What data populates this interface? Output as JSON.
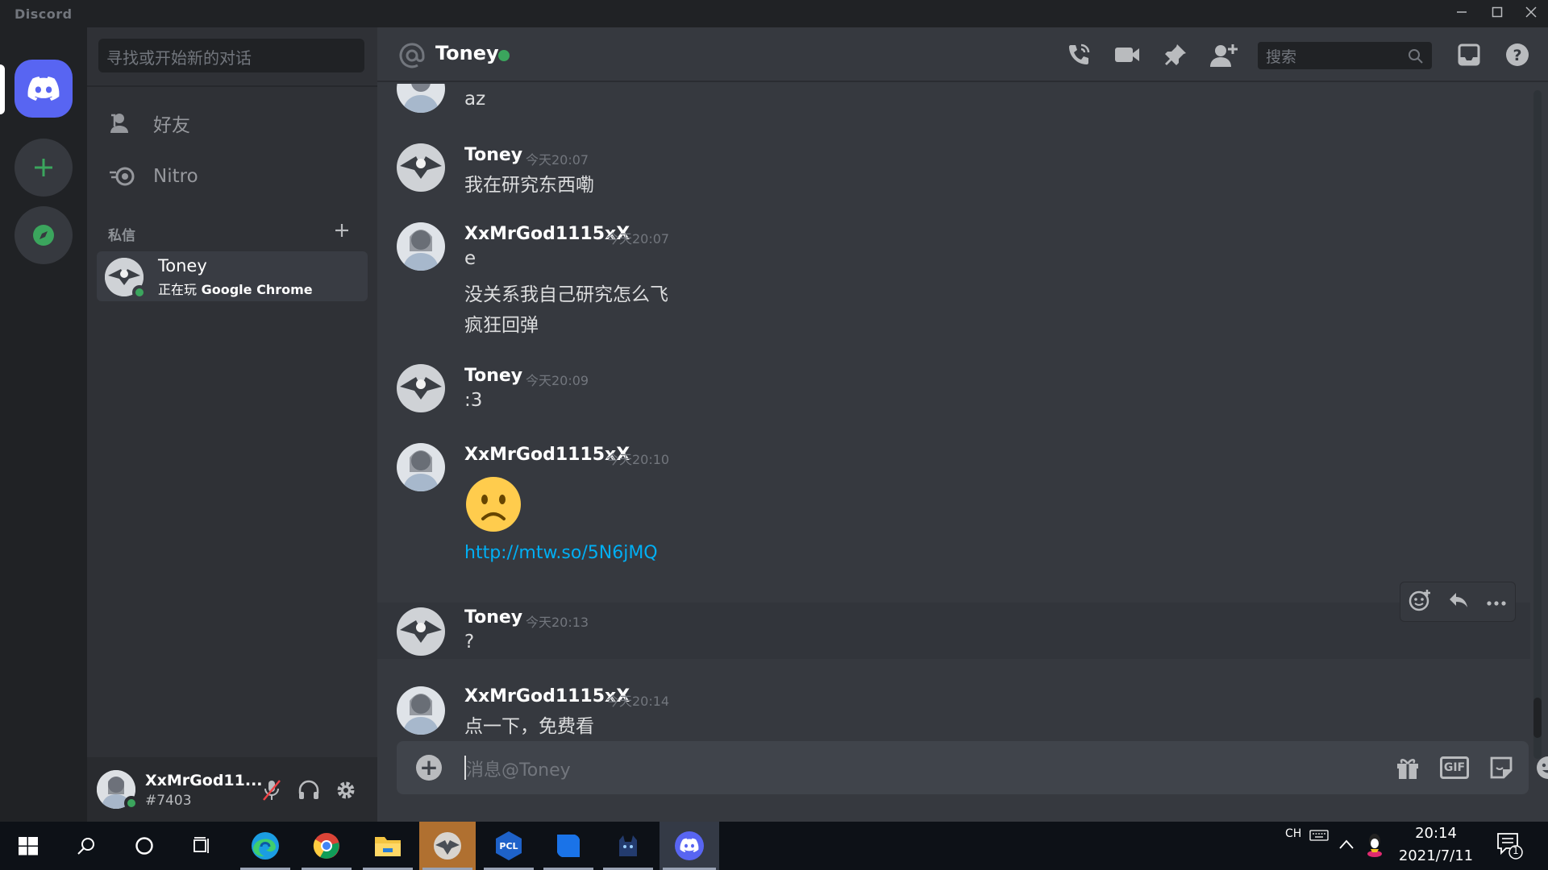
{
  "window": {
    "app_title": "Discord",
    "controls": [
      "minimize",
      "maximize",
      "close"
    ]
  },
  "guilds": {
    "items": [
      {
        "name": "home",
        "icon": "discord-logo-icon"
      },
      {
        "name": "add-server",
        "icon": "plus-icon"
      },
      {
        "name": "explore",
        "icon": "compass-icon"
      }
    ]
  },
  "sidebar": {
    "search_placeholder": "寻找或开始新的对话",
    "nav": [
      {
        "label": "好友",
        "icon": "friends-icon"
      },
      {
        "label": "Nitro",
        "icon": "nitro-icon"
      }
    ],
    "dm_header": "私信",
    "dm_add_icon": "plus-icon",
    "dms": [
      {
        "name": "Toney",
        "activity_prefix": "正在玩",
        "activity_game": "Google Chrome",
        "status": "online"
      }
    ]
  },
  "user_panel": {
    "name": "XxMrGod11...",
    "tag": "#7403",
    "status": "online",
    "buttons": [
      "mute-mic-icon",
      "headphones-icon",
      "settings-gear-icon"
    ]
  },
  "header": {
    "channel_name": "Toney",
    "status": "online",
    "buttons": [
      "voice-call-icon",
      "video-call-icon",
      "pinned-messages-icon",
      "add-friend-dm-icon"
    ],
    "search_placeholder": "搜索",
    "extra_buttons": [
      "inbox-icon",
      "help-icon"
    ]
  },
  "messages": [
    {
      "author": "",
      "time": "",
      "lines": [
        "az"
      ]
    },
    {
      "author": "Toney",
      "time": "今天20:07",
      "lines": [
        "我在研究东西嘞"
      ]
    },
    {
      "author": "XxMrGod1115xX",
      "time": "今天20:07",
      "lines": [
        "e",
        "没关系我自己研究怎么飞",
        "疯狂回弹"
      ]
    },
    {
      "author": "Toney",
      "time": "今天20:09",
      "lines": [
        ":3"
      ]
    },
    {
      "author": "XxMrGod1115xX",
      "time": "今天20:10",
      "emoji": "😦",
      "link": "http://mtw.so/5N6jMQ"
    },
    {
      "author": "Toney",
      "time": "今天20:13",
      "lines": [
        "?"
      ]
    },
    {
      "author": "XxMrGod1115xX",
      "time": "今天20:14",
      "lines": [
        "点一下，免费看"
      ]
    }
  ],
  "hover_actions": [
    "add-reaction-icon",
    "reply-icon",
    "more-icon"
  ],
  "composer": {
    "placeholder": "消息@Toney",
    "buttons": [
      "gift-icon",
      "gif-button",
      "sticker-icon",
      "emoji-icon"
    ],
    "gif_label": "GIF"
  },
  "taskbar": {
    "apps": [
      "windows-start-icon",
      "search-icon",
      "cortana-icon",
      "task-view-icon",
      "edge-icon",
      "chrome-icon",
      "file-explorer-icon",
      "game-launcher-icon",
      "pcl-icon",
      "blue-app-icon",
      "cat-app-icon",
      "discord-icon"
    ],
    "pcl_label": "PCL",
    "lang": "CH",
    "time": "20:14",
    "date": "2021/7/11",
    "notification_count": "1"
  },
  "colors": {
    "accent": "#5865f2",
    "online": "#3ba55d",
    "link": "#00aff4",
    "background": "#36393f",
    "sidebar": "#2f3136"
  }
}
